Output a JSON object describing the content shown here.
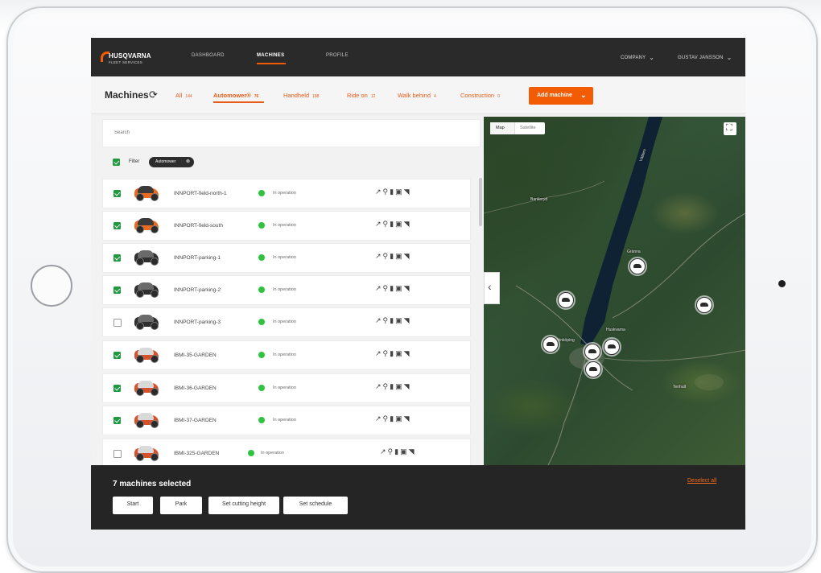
{
  "topbar": {
    "logo_name": "HUSQVARNA",
    "logo_sub": "FLEET SERVICES",
    "nav": [
      "DASHBOARD",
      "MACHINES",
      "PROFILE"
    ],
    "company": "COMPANY",
    "user": "GUSTAV JANSSON"
  },
  "header": {
    "title": "Machines",
    "tabs": [
      {
        "label": "All",
        "count": "144"
      },
      {
        "label": "Automower®",
        "count": "76"
      },
      {
        "label": "Handheld",
        "count": "188"
      },
      {
        "label": "Ride on",
        "count": "12"
      },
      {
        "label": "Walk behind",
        "count": "4"
      },
      {
        "label": "Construction",
        "count": "0"
      }
    ],
    "add_label": "Add machine"
  },
  "list": {
    "search_placeholder": "Search",
    "filter_label": "Filter",
    "chip_label": "Automower",
    "rows": [
      {
        "name": "INNPORT-field-north-1",
        "status": "In operation",
        "checked": true,
        "color": "#ec6a1e"
      },
      {
        "name": "INNPORT-field-south",
        "status": "In operation",
        "checked": true,
        "color": "#ec6a1e"
      },
      {
        "name": "INNPORT-parking-1",
        "status": "In operation",
        "checked": true,
        "color": "#2f2f2f"
      },
      {
        "name": "INNPORT-parking-2",
        "status": "In operation",
        "checked": true,
        "color": "#2f2f2f"
      },
      {
        "name": "INNPORT-parking-3",
        "status": "In operation",
        "checked": false,
        "color": "#2f2f2f"
      },
      {
        "name": "IBMI-35-GARDEN",
        "status": "In operation",
        "checked": true,
        "color": "#d8512a"
      },
      {
        "name": "IBMI-36-GARDEN",
        "status": "In operation",
        "checked": true,
        "color": "#d8512a"
      },
      {
        "name": "IBMI-37-GARDEN",
        "status": "In operation",
        "checked": true,
        "color": "#d8512a"
      },
      {
        "name": "IBMI-325-GARDEN",
        "status": "In operation",
        "checked": false,
        "color": "#d8512a"
      }
    ]
  },
  "map": {
    "map_label": "Map",
    "sat_label": "Satellite",
    "places": [
      "Vättern",
      "Gränna",
      "Jönköping",
      "Huskvarna",
      "Bankeryd",
      "Tenhult"
    ]
  },
  "bottom": {
    "selected": "7 machines selected",
    "deselect": "Deselect all",
    "buttons": [
      "Start",
      "Park",
      "Set cutting height",
      "Set schedule"
    ]
  }
}
